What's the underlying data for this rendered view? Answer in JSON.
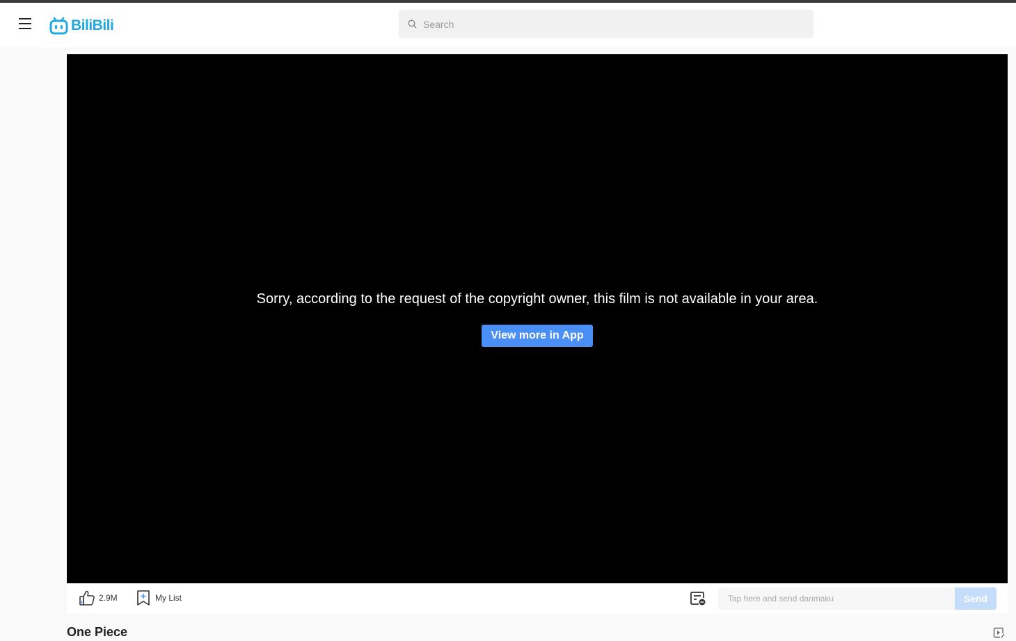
{
  "header": {
    "logo_text": "BiliBili",
    "search_placeholder": "Search"
  },
  "player": {
    "message": "Sorry, according to the request of the copyright owner, this film is not available in your area.",
    "app_button_label": "View more in App"
  },
  "actions": {
    "like_count": "2.9M",
    "mylist_label": "My List",
    "danmaku_placeholder": "Tap here and send danmaku",
    "send_label": "Send"
  },
  "video": {
    "title": "One Piece"
  },
  "colors": {
    "brand": "#20a8e0",
    "accent": "#4a8ff5",
    "send_disabled": "#c6dcfb"
  }
}
